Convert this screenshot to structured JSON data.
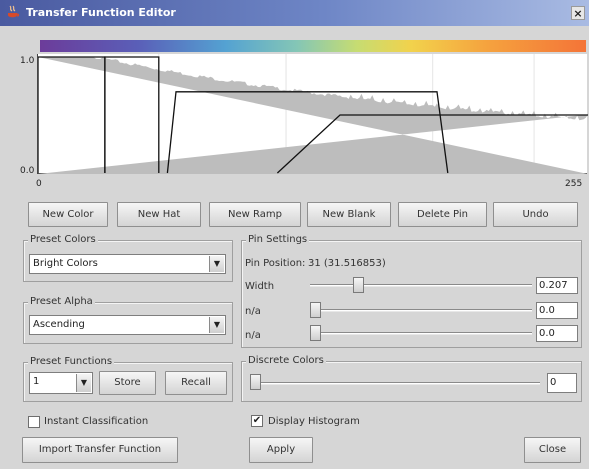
{
  "window": {
    "title": "Transfer Function Editor",
    "close_glyph": "×"
  },
  "plot": {
    "y_max_label": "1.0",
    "y_min_label": "0.0",
    "x_min_label": "0",
    "x_max_label": "255"
  },
  "chart_data": {
    "type": "line",
    "xlim": [
      0,
      255
    ],
    "ylim": [
      0,
      1
    ],
    "x_tick_labels": [
      "0",
      "255"
    ],
    "y_tick_labels": [
      "0.0",
      "1.0"
    ],
    "series": [
      {
        "points": [
          [
            0,
            0
          ],
          [
            0,
            1
          ],
          [
            31,
            1
          ],
          [
            31,
            0
          ]
        ]
      },
      {
        "points": [
          [
            31,
            0
          ],
          [
            31,
            1
          ],
          [
            56,
            1
          ],
          [
            56,
            0
          ]
        ]
      },
      {
        "points": [
          [
            60,
            0
          ],
          [
            64,
            0.7
          ],
          [
            185,
            0.7
          ],
          [
            190,
            0
          ]
        ]
      },
      {
        "points": [
          [
            111,
            0
          ],
          [
            140,
            0.5
          ],
          [
            255,
            0.5
          ]
        ]
      }
    ],
    "histogram": "decreasing density, high near 0"
  },
  "toolbar": {
    "new_color": "New Color",
    "new_hat": "New Hat",
    "new_ramp": "New Ramp",
    "new_blank": "New Blank",
    "delete_pin": "Delete Pin",
    "undo": "Undo"
  },
  "preset_colors": {
    "title": "Preset Colors",
    "selected": "Bright Colors"
  },
  "preset_alpha": {
    "title": "Preset Alpha",
    "selected": "Ascending"
  },
  "preset_functions": {
    "title": "Preset Functions",
    "selected": "1",
    "store": "Store",
    "recall": "Recall"
  },
  "pin_settings": {
    "title": "Pin Settings",
    "position_label": "Pin Position:",
    "position_value": "31 (31.516853)",
    "width_label": "Width",
    "width_value": "0.207",
    "na1_label": "n/a",
    "na1_value": "0.0",
    "na2_label": "n/a",
    "na2_value": "0.0"
  },
  "discrete_colors": {
    "title": "Discrete Colors",
    "value": "0"
  },
  "options": {
    "instant_classification": "Instant Classification",
    "display_histogram": "Display Histogram",
    "instant_checked": false,
    "histogram_checked": true
  },
  "footer": {
    "import": "Import Transfer Function",
    "apply": "Apply",
    "close": "Close"
  }
}
